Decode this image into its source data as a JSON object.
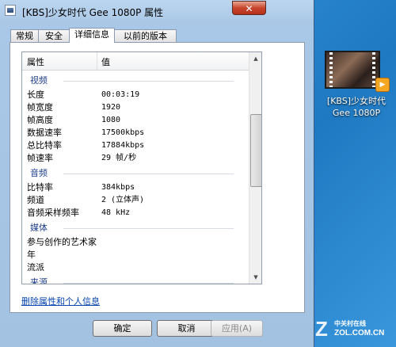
{
  "window": {
    "title": "[KBS]少女时代 Gee 1080P 属性",
    "close_label": "✕"
  },
  "tabs": [
    {
      "label": "常规"
    },
    {
      "label": "安全"
    },
    {
      "label": "详细信息",
      "active": true
    },
    {
      "label": "以前的版本"
    }
  ],
  "details": {
    "header": {
      "property": "属性",
      "value": "值"
    },
    "sections": [
      {
        "title": "视频",
        "rows": [
          {
            "k": "长度",
            "v": "00:03:19"
          },
          {
            "k": "帧宽度",
            "v": "1920"
          },
          {
            "k": "帧高度",
            "v": "1080"
          },
          {
            "k": "数据速率",
            "v": "17500kbps"
          },
          {
            "k": "总比特率",
            "v": "17884kbps"
          },
          {
            "k": "帧速率",
            "v": "29 帧/秒"
          }
        ]
      },
      {
        "title": "音频",
        "rows": [
          {
            "k": "比特率",
            "v": "384kbps"
          },
          {
            "k": "频道",
            "v": "2 (立体声)"
          },
          {
            "k": "音频采样频率",
            "v": "48 kHz"
          }
        ]
      },
      {
        "title": "媒体",
        "rows": [
          {
            "k": "参与创作的艺术家",
            "v": ""
          },
          {
            "k": "年",
            "v": ""
          },
          {
            "k": "流派",
            "v": ""
          }
        ]
      },
      {
        "title": "来源",
        "rows": []
      }
    ]
  },
  "remove_link": "删除属性和个人信息",
  "buttons": {
    "ok": "确定",
    "cancel": "取消",
    "apply": "应用(A)"
  },
  "desktop_icon": {
    "label_line1": "[KBS]少女时代",
    "label_line2": "Gee 1080P"
  },
  "watermark": {
    "brand": "中关村在线",
    "url": "ZOL.COM.CN",
    "mark": "Z"
  }
}
